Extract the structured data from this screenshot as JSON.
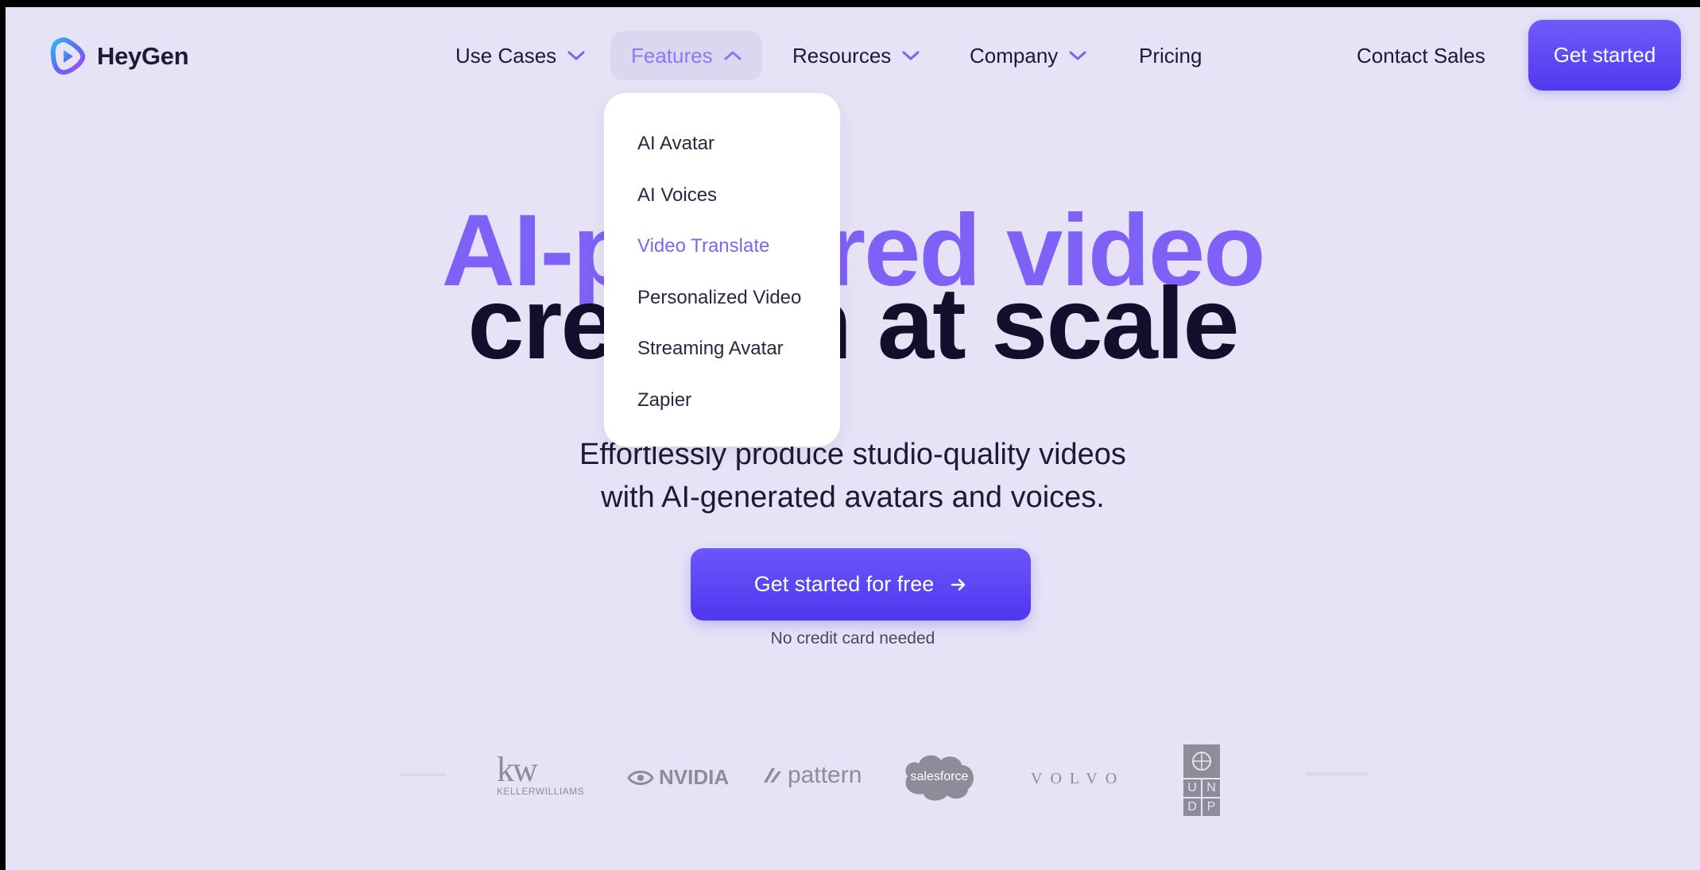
{
  "brand": {
    "name": "HeyGen"
  },
  "nav": {
    "items": [
      {
        "label": "Use Cases"
      },
      {
        "label": "Features"
      },
      {
        "label": "Resources"
      },
      {
        "label": "Company"
      },
      {
        "label": "Pricing"
      }
    ],
    "contact": "Contact Sales",
    "get_started": "Get started"
  },
  "dropdown": {
    "items": [
      "AI Avatar",
      "AI Voices",
      "Video Translate",
      "Personalized Video",
      "Streaming Avatar",
      "Zapier"
    ]
  },
  "hero": {
    "line1": "AI-powered video",
    "line2": "creation at scale",
    "sub1": "Effortlessly produce studio-quality videos",
    "sub2": "with AI-generated avatars and voices.",
    "cta": "Get started for free",
    "note": "No credit card needed"
  },
  "logos": {
    "kw_big": "kw",
    "kw_small": "KELLERWILLIAMS",
    "nvidia": "NVIDIA",
    "pattern": "pattern",
    "salesforce": "salesforce",
    "volvo": "VOLVO",
    "undp": [
      "U",
      "N",
      "D",
      "P"
    ]
  },
  "colors": {
    "accent": "#5139ef",
    "accent_light": "#8061f8",
    "background": "#e6e3f6",
    "text_dark": "#120f2c"
  }
}
